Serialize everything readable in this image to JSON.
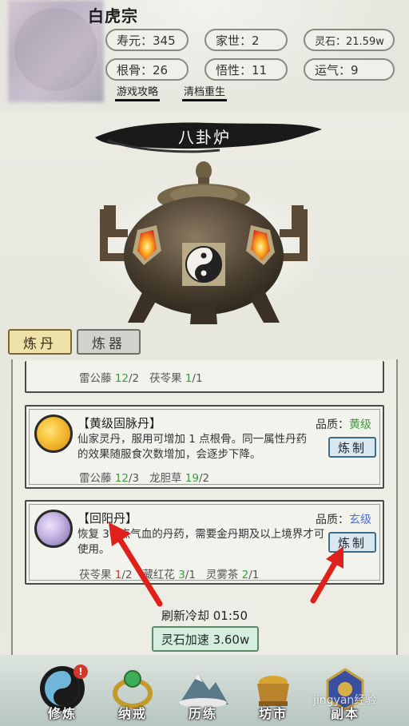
{
  "header": {
    "sect_name": "白虎宗",
    "stats": {
      "lifespan": "寿元：345",
      "family": "家世：2",
      "spirit_stones": "灵石：21.59w",
      "root": "根骨：26",
      "comprehension": "悟性：11",
      "luck": "运气：9"
    },
    "links": {
      "guide": "游戏攻略",
      "reset": "清档重生"
    }
  },
  "furnace": {
    "title": "八卦炉"
  },
  "tabs": {
    "alchemy": "炼丹",
    "forge": "炼器"
  },
  "recipes": [
    {
      "partial": true,
      "ingredients": [
        {
          "name": "雷公藤",
          "have": "12",
          "need": "/2",
          "enough": true
        },
        {
          "name": "茯苓果",
          "have": "1",
          "need": "/1",
          "enough": true
        }
      ]
    },
    {
      "name": "【黄级固脉丹】",
      "quality_label": "品质：",
      "quality": "黄级",
      "quality_color": "#3c9b3c",
      "desc": "仙家灵丹，服用可增加 1 点根骨。同一属性丹药的效果随服食次数增加，会逐步下降。",
      "button": "炼制",
      "icon_colors": [
        "#f6c23a",
        "#e08a10"
      ],
      "ingredients": [
        {
          "name": "雷公藤",
          "have": "12",
          "need": "/3",
          "enough": true
        },
        {
          "name": "龙胆草",
          "have": "19",
          "need": "/2",
          "enough": true
        }
      ]
    },
    {
      "name": "【回阳丹】",
      "quality_label": "品质：",
      "quality": "玄级",
      "quality_color": "#4a6fd0",
      "desc": "恢复 30 点气血的丹药，需要金丹期及以上境界才可使用。",
      "button": "炼制",
      "icon_colors": [
        "#c7b6e4",
        "#7a6aa8"
      ],
      "ingredients": [
        {
          "name": "茯苓果",
          "have": "1",
          "need": "/2",
          "enough": false
        },
        {
          "name": "藏红花",
          "have": "3",
          "need": "/1",
          "enough": true
        },
        {
          "name": "灵雾茶",
          "have": "2",
          "need": "/1",
          "enough": true
        }
      ]
    }
  ],
  "cooldown": "刷新冷却 01:50",
  "speed_button": "灵石加速 3.60w",
  "nav": [
    {
      "label": "修炼",
      "icon": "yin-yang-icon",
      "badge": "!"
    },
    {
      "label": "纳戒",
      "icon": "ring-icon"
    },
    {
      "label": "历练",
      "icon": "mountain-icon"
    },
    {
      "label": "坊市",
      "icon": "market-icon"
    },
    {
      "label": "副本",
      "icon": "dungeon-icon"
    }
  ],
  "watermark": "jingyan经验"
}
